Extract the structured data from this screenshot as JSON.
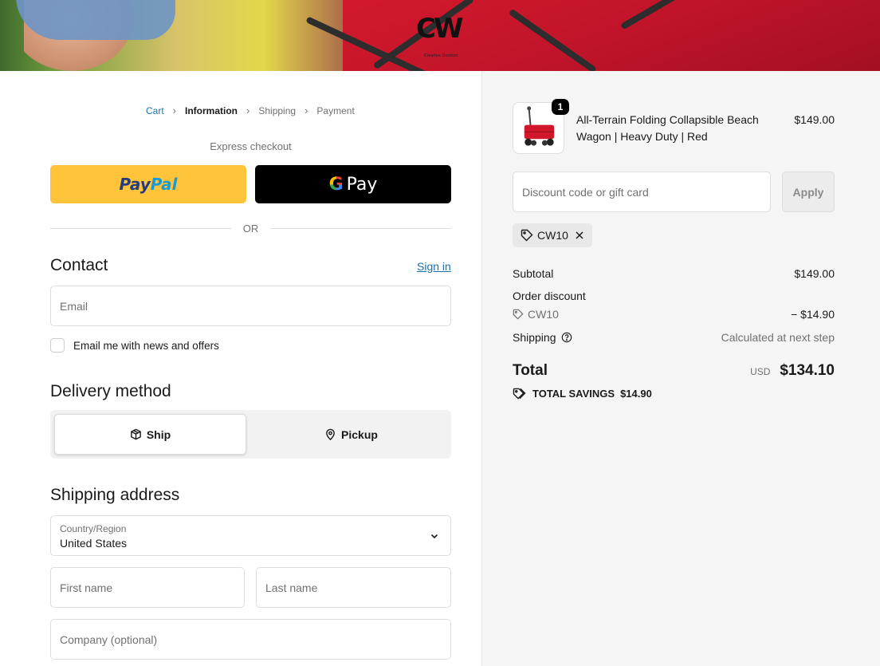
{
  "brand": {
    "logo_text": "CW",
    "logo_subtext": "Creative Outdoor Wagons"
  },
  "breadcrumb": [
    "Cart",
    "Information",
    "Shipping",
    "Payment"
  ],
  "express": {
    "label": "Express checkout",
    "or": "OR"
  },
  "contact": {
    "title": "Contact",
    "sign_in": "Sign in",
    "email_placeholder": "Email",
    "newsletter_label": "Email me with news and offers"
  },
  "delivery": {
    "title": "Delivery method",
    "ship_label": "Ship",
    "pickup_label": "Pickup"
  },
  "shipping_address": {
    "title": "Shipping address",
    "country_label": "Country/Region",
    "country_value": "United States",
    "first_name_placeholder": "First name",
    "last_name_placeholder": "Last name",
    "company_placeholder": "Company (optional)"
  },
  "summary": {
    "product": {
      "quantity": "1",
      "name": "All-Terrain Folding Collapsible Beach Wagon | Heavy Duty | Red",
      "price": "$149.00"
    },
    "discount_placeholder": "Discount code or gift card",
    "apply_label": "Apply",
    "applied_code": "CW10",
    "subtotal_label": "Subtotal",
    "subtotal_value": "$149.00",
    "order_discount_label": "Order discount",
    "discount_code": "CW10",
    "discount_value": "− $14.90",
    "shipping_label": "Shipping",
    "shipping_value": "Calculated at next step",
    "total_label": "Total",
    "currency": "USD",
    "total_value": "$134.10",
    "savings_label": "TOTAL SAVINGS",
    "savings_value": "$14.90"
  },
  "colors": {
    "paypal_yellow": "#ffc439",
    "link_blue": "#1773b0",
    "summary_bg": "#f5f5f5"
  }
}
